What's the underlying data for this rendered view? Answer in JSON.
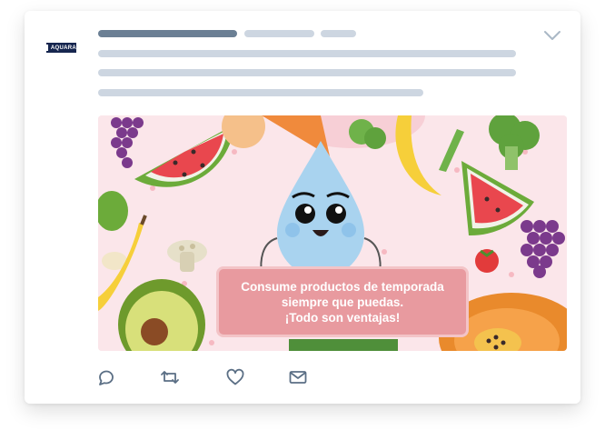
{
  "account": {
    "avatar_text": "AQUARA"
  },
  "tweet": {
    "image": {
      "banner_lines": [
        "Consume productos de temporada",
        "siempre que puedas.",
        "¡Todo son ventajas!"
      ]
    }
  },
  "actions": [
    {
      "icon": "reply-icon"
    },
    {
      "icon": "retweet-icon"
    },
    {
      "icon": "like-icon"
    },
    {
      "icon": "share-icon"
    }
  ],
  "colors": {
    "placeholder_bar": "#cdd6e1",
    "name_bar": "#6b7f94",
    "icon": "#5b6f85",
    "banner": "#e89a9f"
  }
}
